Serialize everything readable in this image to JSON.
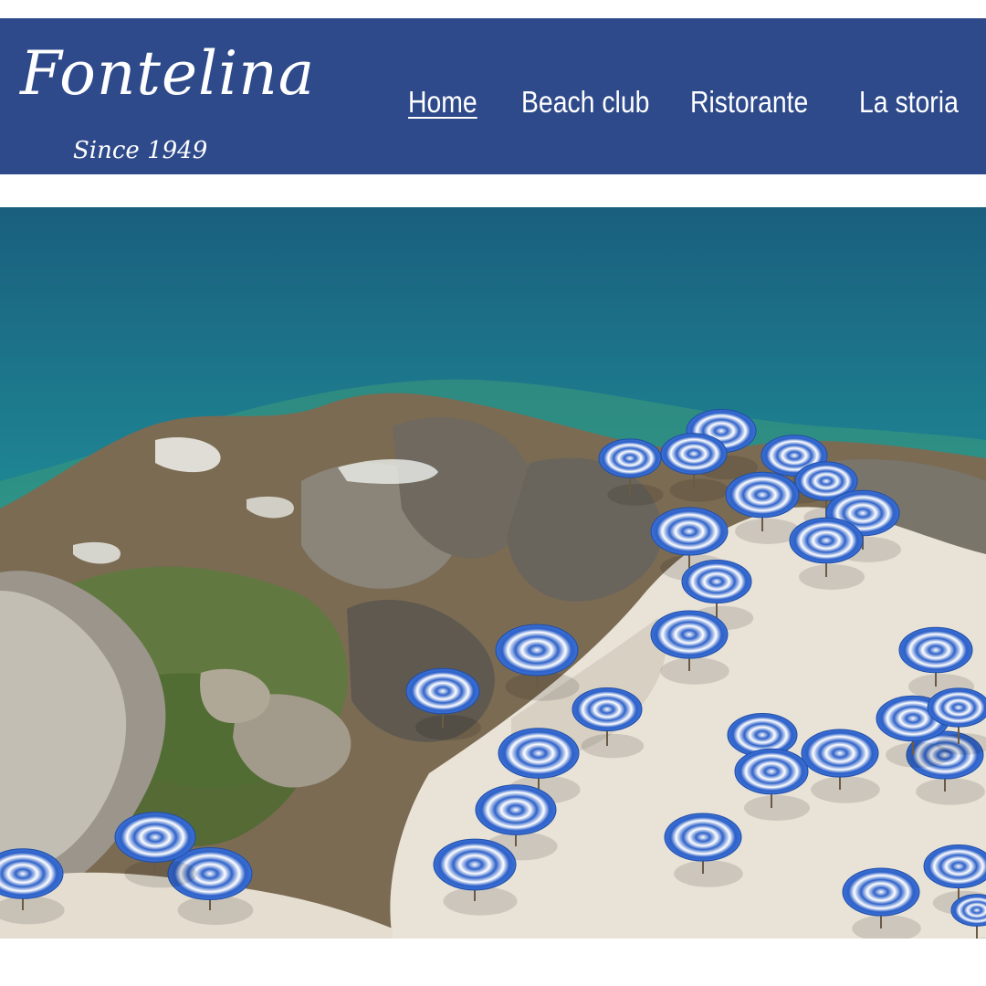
{
  "brand": {
    "name": "Fontelina",
    "tagline": "Since 1949"
  },
  "nav": {
    "items": [
      {
        "label": "Home",
        "active": true
      },
      {
        "label": "Beach club",
        "active": false
      },
      {
        "label": "Ristorante",
        "active": false
      },
      {
        "label": "La storia",
        "active": false
      }
    ]
  },
  "colors": {
    "header_bg": "#2e4a8b",
    "nav_text": "#ffffff",
    "sea_deep": "#1d6f86",
    "sea_shallow": "#1fa79a",
    "rock": "#8c7f6d",
    "umbrella_blue": "#2f62c9",
    "umbrella_white": "#ffffff"
  },
  "hero": {
    "icon": "beach-photo",
    "subject": "aerial-beach-club"
  }
}
